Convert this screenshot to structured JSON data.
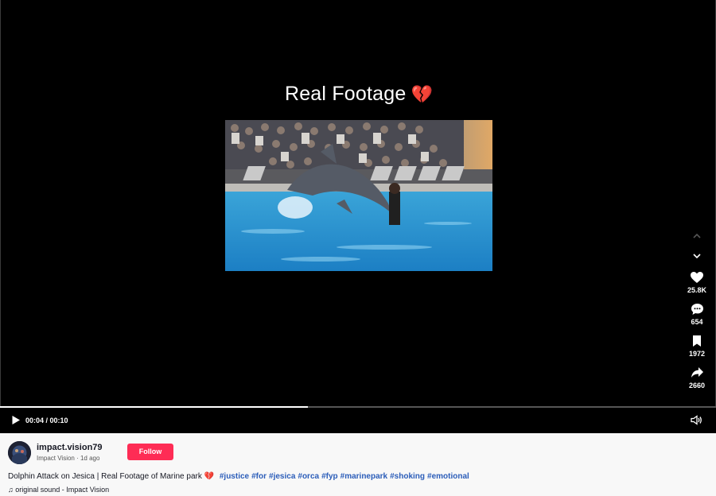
{
  "video": {
    "overlay_title": "Real Footage",
    "overlay_emoji": "💔",
    "progress_fraction": 0.43,
    "time_display": "00:04 / 00:10"
  },
  "actions": {
    "likes": "25.8K",
    "comments": "654",
    "saves": "1972",
    "shares": "2660"
  },
  "author": {
    "username": "impact.vision79",
    "display_name": "Impact Vision",
    "posted": "1d ago",
    "separator": " · "
  },
  "follow_label": "Follow",
  "caption": {
    "text": "Dolphin Attack on Jesica | Real Footage of Marine park",
    "emoji": "💔",
    "hashtags": [
      "#justice",
      "#for",
      "#jesica",
      "#orca",
      "#fyp",
      "#marinepark",
      "#shoking",
      "#emotional"
    ]
  },
  "sound": {
    "label": "original sound - Impact Vision"
  },
  "colors": {
    "accent": "#fe2c55",
    "hashtag": "#2b5db9",
    "background": "#000000"
  }
}
